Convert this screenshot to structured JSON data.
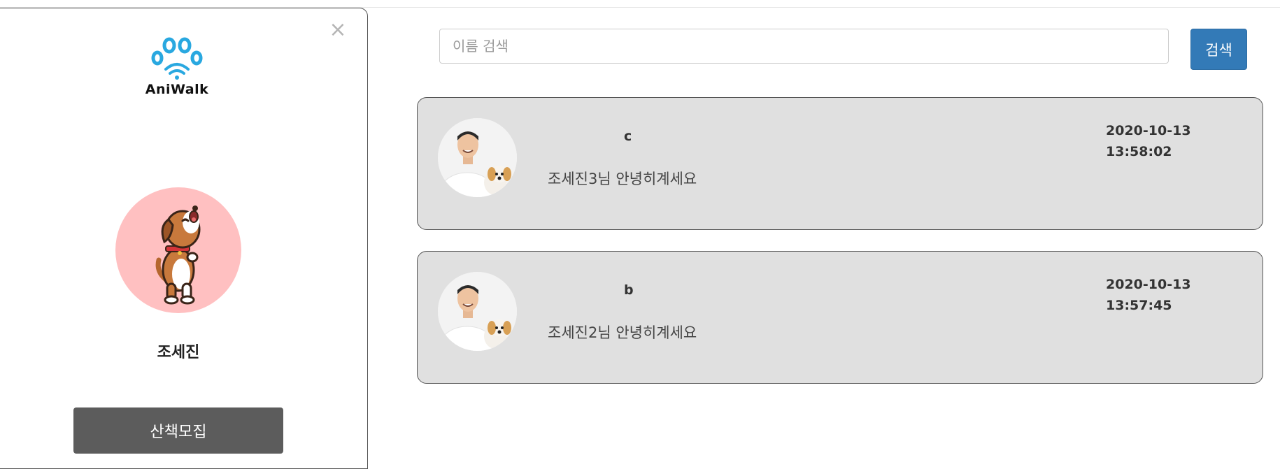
{
  "sidebar": {
    "close_label": "×",
    "logo_text": "AniWalk",
    "logo_icon": "paw-wifi-icon",
    "profile_name": "조세진",
    "profile_avatar": "dog-avatar",
    "walk_button_label": "산책모집"
  },
  "search": {
    "placeholder": "이름 검색",
    "value": "",
    "button_label": "검색"
  },
  "messages": [
    {
      "sender": "c",
      "text": "조세진3님 안녕히계세요",
      "date": "2020-10-13",
      "time": "13:58:02",
      "avatar": "person-with-dog-photo"
    },
    {
      "sender": "b",
      "text": "조세진2님 안녕히계세요",
      "date": "2020-10-13",
      "time": "13:57:45",
      "avatar": "person-with-dog-photo"
    }
  ],
  "colors": {
    "brand_blue": "#29a8e0",
    "button_blue": "#337ab7",
    "card_bg": "#e0e0e0",
    "avatar_bg": "#ffc0c1",
    "walk_button": "#5c5c5c"
  }
}
